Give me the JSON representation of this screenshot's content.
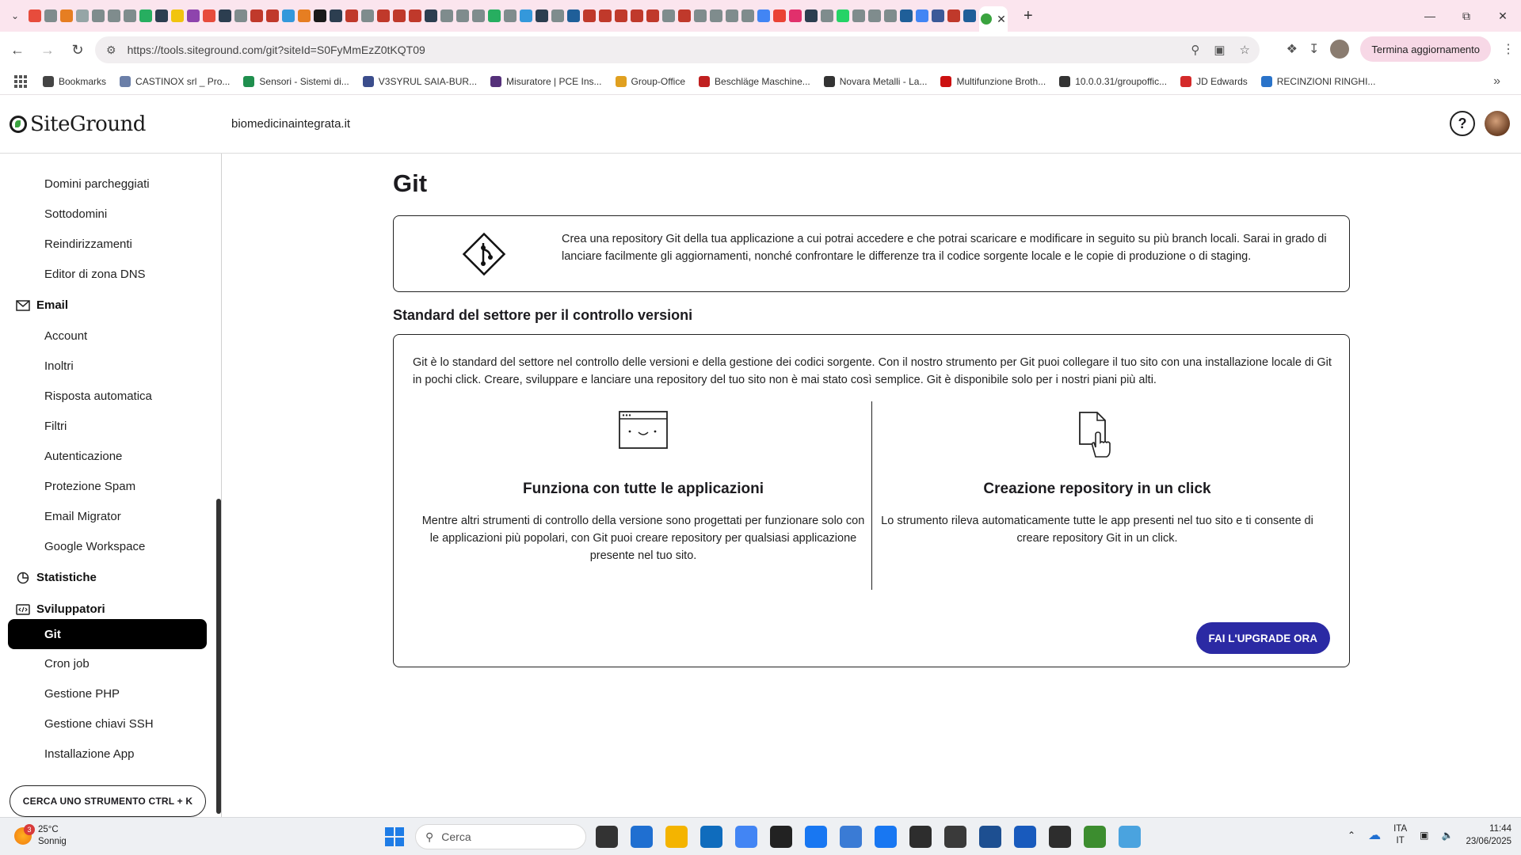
{
  "browser": {
    "url": "https://tools.siteground.com/git?siteId=S0FyMmEzZ0tKQT09",
    "update_button": "Termina aggiornamento",
    "bookmarks": [
      {
        "label": "Bookmarks",
        "color": "#444444"
      },
      {
        "label": "CASTINOX srl _ Pro...",
        "color": "#6b7fa8"
      },
      {
        "label": "Sensori - Sistemi di...",
        "color": "#1f8f4e"
      },
      {
        "label": "V3SYRUL SAIA-BUR...",
        "color": "#3b4d8c"
      },
      {
        "label": "Misuratore | PCE Ins...",
        "color": "#55307a"
      },
      {
        "label": "Group-Office",
        "color": "#e0a020"
      },
      {
        "label": "Beschläge Maschine...",
        "color": "#c02020"
      },
      {
        "label": "Novara Metalli - La...",
        "color": "#333333"
      },
      {
        "label": "Multifunzione Broth...",
        "color": "#cc1111"
      },
      {
        "label": "10.0.0.31/groupoffic...",
        "color": "#333333"
      },
      {
        "label": "JD Edwards",
        "color": "#d42a2a"
      },
      {
        "label": "RECINZIONI RINGHI...",
        "color": "#2a73c9"
      }
    ],
    "tab_favicon_colors": [
      "#e74c3c",
      "#7f8c8d",
      "#e67e22",
      "#95a5a6",
      "#7f8c8d",
      "#7f8c8d",
      "#7f8c8d",
      "#27ae60",
      "#2c3e50",
      "#f1c40f",
      "#8e44ad",
      "#e74c3c",
      "#2c3e50",
      "#7f8c8d",
      "#c0392b",
      "#c0392b",
      "#3498db",
      "#e67e22",
      "#1a1a1a",
      "#2c3e50",
      "#c0392b",
      "#7f8c8d",
      "#c0392b",
      "#c0392b",
      "#c0392b",
      "#2c3e50",
      "#7f8c8d",
      "#7f8c8d",
      "#7f8c8d",
      "#27ae60",
      "#7f8c8d",
      "#3498db",
      "#2c3e50",
      "#7f8c8d",
      "#1f5f99",
      "#c0392b",
      "#c0392b",
      "#c0392b",
      "#c0392b",
      "#c0392b",
      "#7f8c8d",
      "#c0392b",
      "#7f8c8d",
      "#7f8c8d",
      "#7f8c8d",
      "#7f8c8d",
      "#4285f4",
      "#ea4335",
      "#e1306c",
      "#2c3e50",
      "#7f8c8d",
      "#25d366",
      "#7f8c8d",
      "#7f8c8d",
      "#7f8c8d",
      "#1f5f99",
      "#4285f4",
      "#3b5998",
      "#c0392b",
      "#1f5f99"
    ]
  },
  "header": {
    "logo": "SiteGround",
    "domain": "biomedicinaintegrata.it"
  },
  "sidebar": {
    "items_domain": [
      "Domini parcheggiati",
      "Sottodomini",
      "Reindirizzamenti",
      "Editor di zona DNS"
    ],
    "section_email": "Email",
    "items_email": [
      "Account",
      "Inoltri",
      "Risposta automatica",
      "Filtri",
      "Autenticazione",
      "Protezione Spam",
      "Email Migrator",
      "Google Workspace"
    ],
    "section_stats": "Statistiche",
    "section_dev": "Sviluppatori",
    "active_item": "Git",
    "items_dev": [
      "Cron job",
      "Gestione PHP",
      "Gestione chiavi SSH",
      "Installazione App"
    ],
    "search_button": "CERCA UNO STRUMENTO CTRL + K"
  },
  "main": {
    "title": "Git",
    "intro": "Crea una repository Git della tua applicazione a cui potrai accedere e che potrai scaricare e modificare in seguito su più branch locali. Sarai in grado di lanciare facilmente gli aggiornamenti, nonché confrontare le differenze tra il codice sorgente locale e le copie di produzione o di staging.",
    "section_title": "Standard del settore per il controllo versioni",
    "section_desc": "Git è lo standard del settore nel controllo delle versioni e della gestione dei codici sorgente. Con il nostro strumento per Git puoi collegare il tuo sito con una installazione locale di Git in pochi click. Creare, sviluppare e lanciare una repository del tuo sito non è mai stato così semplice. Git è disponibile solo per i nostri piani più alti.",
    "features": [
      {
        "title": "Funziona con tutte le applicazioni",
        "text": "Mentre altri strumenti di controllo della versione sono progettati per funzionare solo con le applicazioni più popolari, con Git puoi creare repository per qualsiasi applicazione presente nel tuo sito."
      },
      {
        "title": "Creazione repository in un click",
        "text": "Lo strumento rileva automaticamente tutte le app presenti nel tuo sito e ti consente di creare repository Git in un click."
      }
    ],
    "upgrade_button": "FAI L'UPGRADE ORA",
    "accent": "#2b2aa4"
  },
  "taskbar": {
    "weather_temp": "25°C",
    "weather_desc": "Sonnig",
    "weather_badge": "3",
    "search_placeholder": "Cerca",
    "lang_top": "ITA",
    "lang_bottom": "IT",
    "time": "11:44",
    "date": "23/06/2025",
    "app_colors": [
      "#333333",
      "#1f6fd1",
      "#f4b400",
      "#0f6cbd",
      "#4285f4",
      "#222222",
      "#1877f2",
      "#3a7bd5",
      "#1877f2",
      "#2d2d2d",
      "#3a3a3a",
      "#1d4f91",
      "#185abd",
      "#2d2d2d",
      "#3c8d2f",
      "#4aa3df"
    ]
  }
}
